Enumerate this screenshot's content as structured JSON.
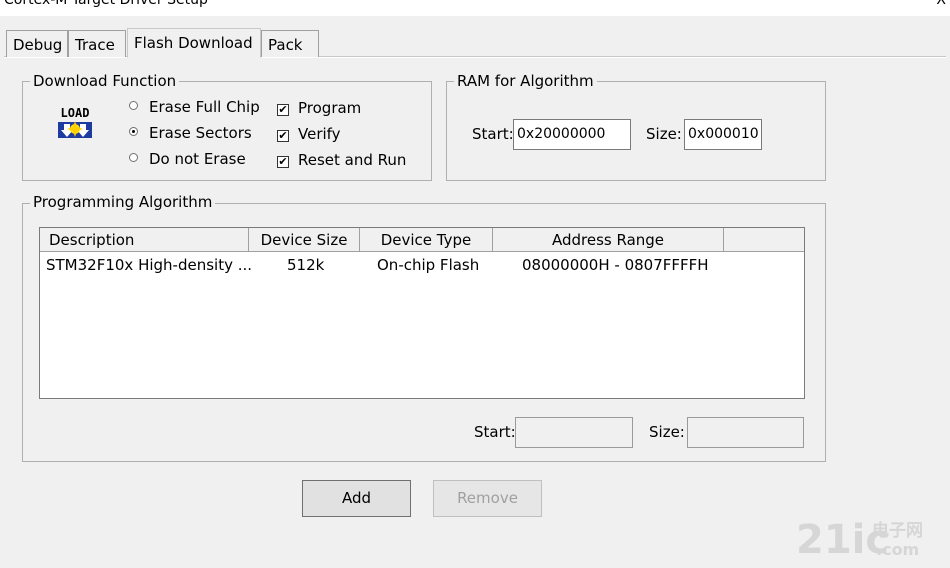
{
  "window": {
    "title": "Cortex-M Target Driver Setup",
    "close_glyph": "X"
  },
  "tabs": [
    {
      "label": "Debug"
    },
    {
      "label": "Trace"
    },
    {
      "label": "Flash Download"
    },
    {
      "label": "Pack"
    }
  ],
  "active_tab": "Flash Download",
  "download_function": {
    "legend": "Download Function",
    "icon_text": "LOAD",
    "radios": [
      {
        "label": "Erase Full Chip",
        "selected": false
      },
      {
        "label": "Erase Sectors",
        "selected": true
      },
      {
        "label": "Do not Erase",
        "selected": false
      }
    ],
    "checks": [
      {
        "label": "Program",
        "checked": true
      },
      {
        "label": "Verify",
        "checked": true
      },
      {
        "label": "Reset and Run",
        "checked": true
      }
    ],
    "check_glyph": "✔"
  },
  "ram": {
    "legend": "RAM for Algorithm",
    "start_label": "Start:",
    "start_value": "0x20000000",
    "size_label": "Size:",
    "size_value": "0x000010"
  },
  "algorithm": {
    "legend": "Programming Algorithm",
    "columns": [
      "Description",
      "Device Size",
      "Device Type",
      "Address Range"
    ],
    "rows": [
      {
        "description": "STM32F10x High-density ...",
        "size": "512k",
        "type": "On-chip Flash",
        "range": "08000000H - 0807FFFFH"
      }
    ],
    "start_label": "Start:",
    "start_value": "",
    "size_label": "Size:",
    "size_value": ""
  },
  "buttons": {
    "add": "Add",
    "remove": "Remove"
  },
  "watermark": {
    "brand": "21ic",
    "cn": "电子网",
    "url": ".com"
  }
}
